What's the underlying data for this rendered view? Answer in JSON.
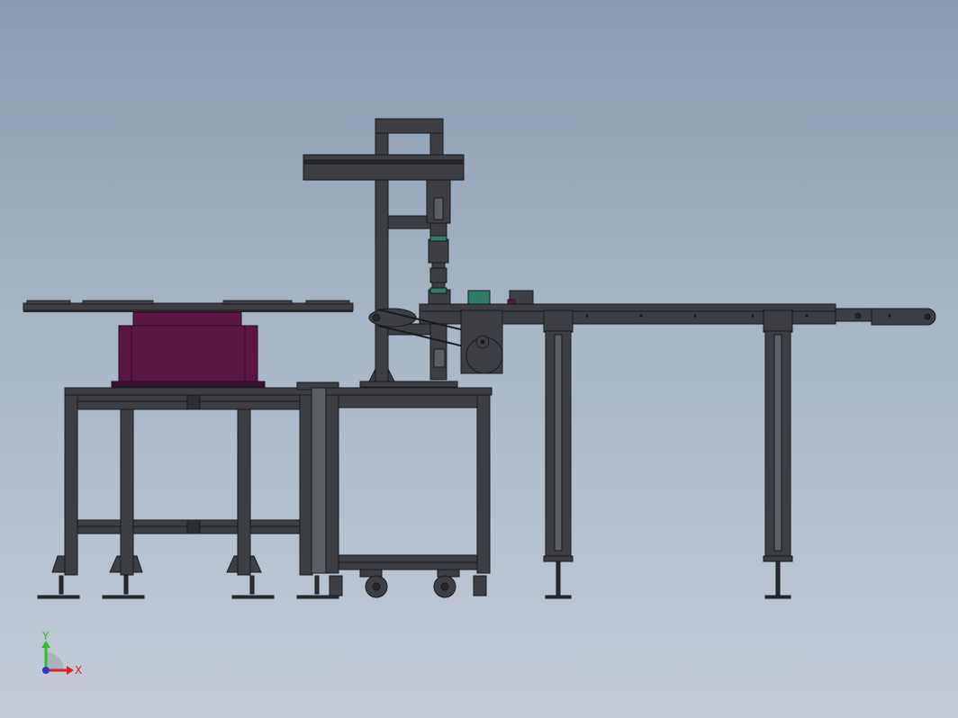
{
  "viewport": {
    "background_top": "#8a9bb0",
    "background_bottom": "#c3ccd7"
  },
  "model": {
    "components": [
      "rotary-index-table",
      "table-frame",
      "mobile-cart",
      "pick-and-place-column",
      "belt-conveyor",
      "conveyor-support-legs",
      "drive-motor"
    ],
    "colors": {
      "frame": "#3d3f44",
      "frame_dark": "#27292d",
      "frame_edge": "#1a1b1e",
      "rotary_base": "#5a1645",
      "rotary_dark": "#3f0e31",
      "sensor_green": "#2f7d66"
    }
  },
  "triad": {
    "y_label": "Y",
    "x_label": "X",
    "y_color": "#2bbf2b",
    "x_color": "#d9251f",
    "z_color": "#2f37c9"
  }
}
